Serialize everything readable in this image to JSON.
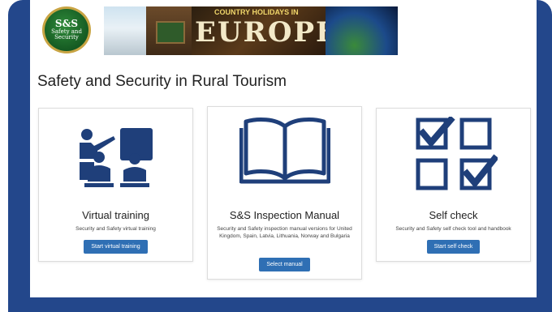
{
  "header": {
    "logo_big": "S&S",
    "logo_small": "Safety and Security",
    "banner_title": "COUNTRY HOLIDAYS IN",
    "banner_word": "EUROPE"
  },
  "page_title": "Safety and Security in Rural Tourism",
  "cards": [
    {
      "icon": "teacher-students-icon",
      "title": "Virtual training",
      "description": "Security and Safety virtual training",
      "button": "Start virtual training"
    },
    {
      "icon": "open-book-icon",
      "title": "S&S Inspection Manual",
      "description": "Security and Safety inspection manual versions for United Kingdom, Spain, Latvia, Lithuania, Norway and Bulgaria",
      "button": "Select manual"
    },
    {
      "icon": "checkboxes-icon",
      "title": "Self check",
      "description": "Security and Safety self check tool and handbook",
      "button": "Start self check"
    }
  ],
  "colors": {
    "frame": "#23478b",
    "icon": "#1f3f7a",
    "button": "#2f6fb4"
  }
}
